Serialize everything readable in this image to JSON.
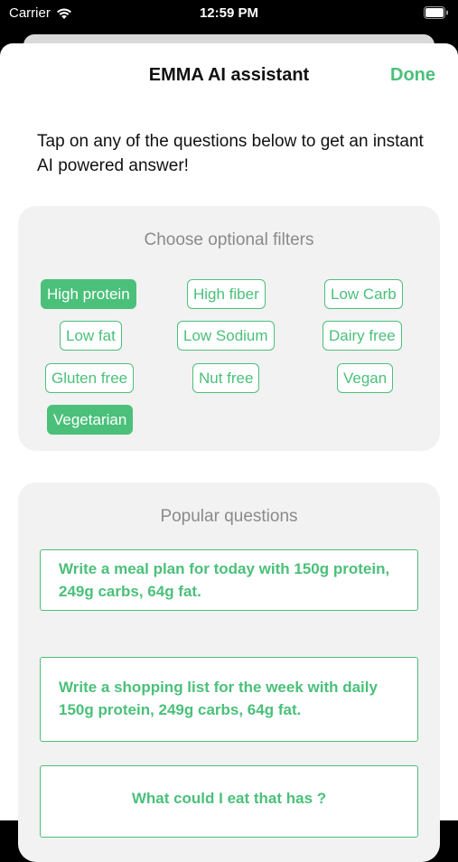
{
  "status_bar": {
    "carrier": "Carrier",
    "time": "12:59 PM"
  },
  "nav": {
    "title": "EMMA AI assistant",
    "done_label": "Done"
  },
  "intro": "Tap on any of the questions below to get an instant AI powered answer!",
  "filters": {
    "heading": "Choose optional filters",
    "chips": [
      {
        "label": "High protein",
        "selected": true
      },
      {
        "label": "High fiber",
        "selected": false
      },
      {
        "label": "Low Carb",
        "selected": false
      },
      {
        "label": "Low fat",
        "selected": false
      },
      {
        "label": "Low Sodium",
        "selected": false
      },
      {
        "label": "Dairy free",
        "selected": false
      },
      {
        "label": "Gluten free",
        "selected": false
      },
      {
        "label": "Nut free",
        "selected": false
      },
      {
        "label": "Vegan",
        "selected": false
      },
      {
        "label": "Vegetarian",
        "selected": true
      }
    ]
  },
  "questions": {
    "heading": "Popular questions",
    "items": [
      "Write a meal plan for today with 150g protein, 249g carbs, 64g fat.",
      "Write a shopping list for the week with daily 150g protein, 249g carbs, 64g fat.",
      "What could I eat that has ?"
    ]
  },
  "colors": {
    "accent": "#4bc07a",
    "card_bg": "#f2f2f2",
    "muted_text": "#8a8a8a"
  }
}
